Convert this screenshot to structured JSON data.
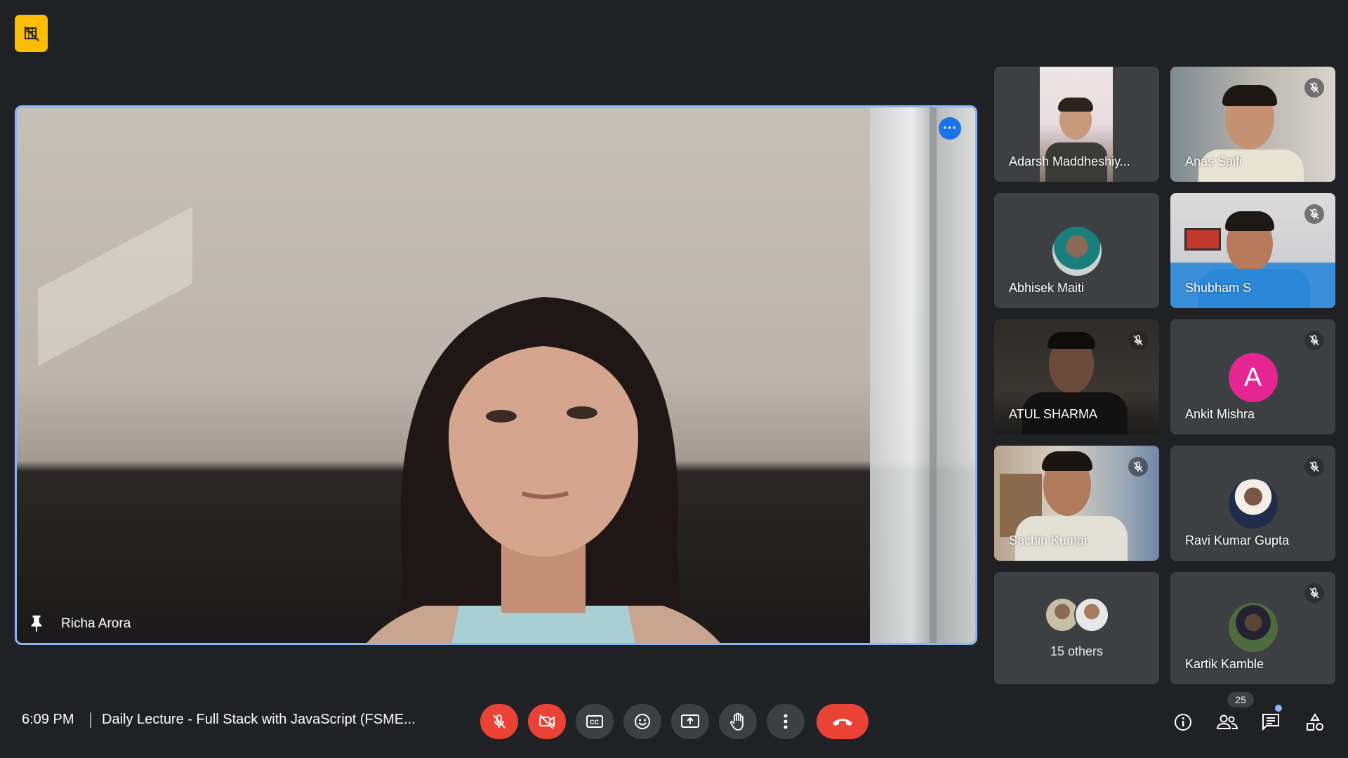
{
  "app": {
    "status_icon": "camera-off-icon",
    "badge_color": "#fbbc04",
    "accent": "#8ab4f8"
  },
  "main_tile": {
    "participant_name": "Richa Arora",
    "pinned": true,
    "more_options_icon": "more-horizontal-icon"
  },
  "participants": [
    {
      "name": "Adarsh Maddheshiy...",
      "muted": false,
      "video": true
    },
    {
      "name": "Anas Saifi",
      "muted": true,
      "video": true
    },
    {
      "name": "Abhisek Maiti",
      "muted": false,
      "video": false
    },
    {
      "name": "Shubham S",
      "muted": true,
      "video": true
    },
    {
      "name": "ATUL SHARMA",
      "muted": true,
      "video": true
    },
    {
      "name": "Ankit Mishra",
      "muted": true,
      "video": false,
      "avatar_letter": "A",
      "avatar_color": "#e52592"
    },
    {
      "name": "Sachin Kumar",
      "muted": true,
      "video": true
    },
    {
      "name": "Ravi Kumar Gupta",
      "muted": true,
      "video": false
    },
    {
      "name": "15 others",
      "muted": false,
      "video": false
    },
    {
      "name": "Kartik Kamble",
      "muted": true,
      "video": false
    }
  ],
  "bottom_bar": {
    "time": "6:09 PM",
    "meeting_title": "Daily Lecture - Full Stack with JavaScript (FSME...",
    "controls": [
      "mic-off-icon",
      "camera-off-icon",
      "captions-icon",
      "emoji-icon",
      "present-screen-icon",
      "raise-hand-icon",
      "more-vert-icon",
      "end-call-icon"
    ],
    "mic_color": "#ea4335",
    "right_icons": [
      "info-icon",
      "people-icon",
      "chat-icon",
      "activities-icon"
    ],
    "people_count": "25"
  }
}
